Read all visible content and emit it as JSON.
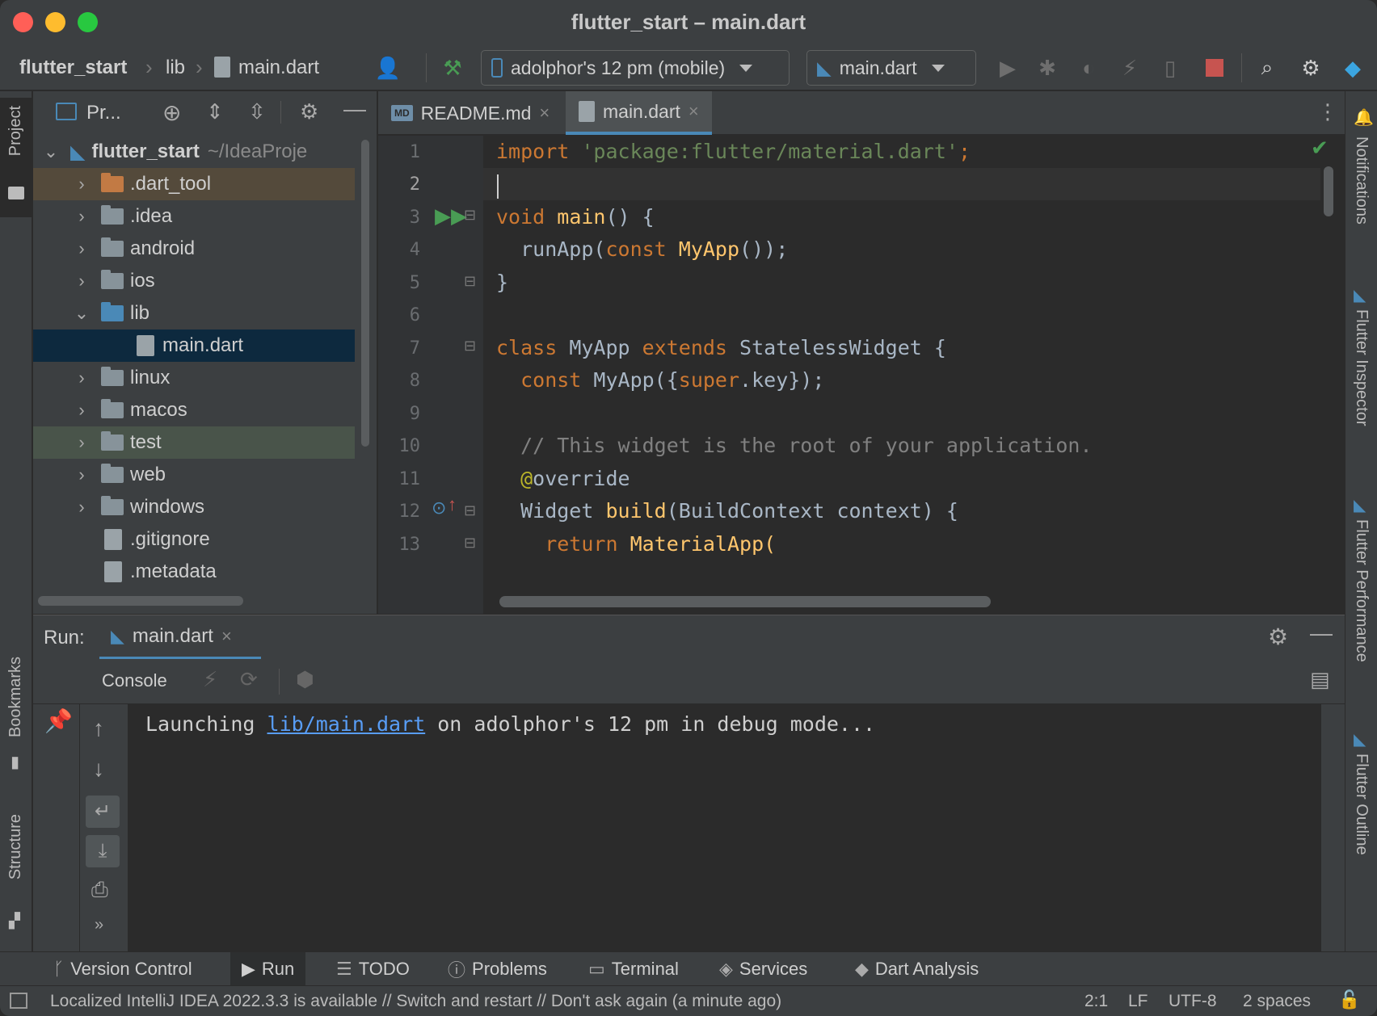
{
  "window": {
    "title": "flutter_start – main.dart"
  },
  "breadcrumb": {
    "project": "flutter_start",
    "folder": "lib",
    "file": "main.dart"
  },
  "toolbar": {
    "device": "adolphor's 12 pm (mobile)",
    "run_config": "main.dart"
  },
  "project_panel": {
    "title": "Pr...",
    "root_name": "flutter_start",
    "root_path": "~/IdeaProje",
    "items": [
      {
        "label": ".dart_tool"
      },
      {
        "label": ".idea"
      },
      {
        "label": "android"
      },
      {
        "label": "ios"
      },
      {
        "label": "lib"
      },
      {
        "label": "main.dart"
      },
      {
        "label": "linux"
      },
      {
        "label": "macos"
      },
      {
        "label": "test"
      },
      {
        "label": "web"
      },
      {
        "label": "windows"
      },
      {
        "label": ".gitignore"
      },
      {
        "label": ".metadata"
      }
    ]
  },
  "editor": {
    "tabs": [
      {
        "label": "README.md",
        "badge": "MD"
      },
      {
        "label": "main.dart"
      }
    ],
    "line_numbers": [
      "1",
      "2",
      "3",
      "4",
      "5",
      "6",
      "7",
      "8",
      "9",
      "10",
      "11",
      "12",
      "13"
    ],
    "lines": {
      "l1a": "import ",
      "l1b": "'package:flutter/material.dart'",
      "l1c": ";",
      "l3a": "void ",
      "l3b": "main",
      "l3c": "() {",
      "l4a": "  runApp(",
      "l4b": "const ",
      "l4c": "MyApp",
      "l4d": "());",
      "l5": "}",
      "l7a": "class ",
      "l7b": "MyApp ",
      "l7c": "extends ",
      "l7d": "StatelessWidget {",
      "l8a": "  const ",
      "l8b": "MyApp({",
      "l8c": "super",
      "l8d": ".key});",
      "l10": "  // This widget is the root of your application.",
      "l11a": "  @",
      "l11b": "override",
      "l12a": "  Widget ",
      "l12b": "build",
      "l12c": "(BuildContext context) {",
      "l13a": "    return ",
      "l13b": "MaterialApp("
    }
  },
  "run_panel": {
    "label": "Run:",
    "tab": "main.dart",
    "console_label": "Console",
    "output_prefix": "Launching ",
    "output_link": "lib/main.dart",
    "output_suffix": " on adolphor's 12 pm in debug mode..."
  },
  "left_strip": {
    "project": "Project",
    "bookmarks": "Bookmarks",
    "structure": "Structure"
  },
  "right_strip": {
    "notifications": "Notifications",
    "inspector": "Flutter Inspector",
    "performance": "Flutter Performance",
    "outline": "Flutter Outline"
  },
  "tool_windows": [
    {
      "label": "Version Control"
    },
    {
      "label": "Run"
    },
    {
      "label": "TODO"
    },
    {
      "label": "Problems"
    },
    {
      "label": "Terminal"
    },
    {
      "label": "Services"
    },
    {
      "label": "Dart Analysis"
    }
  ],
  "status_bar": {
    "message": "Localized IntelliJ IDEA 2022.3.3 is available // Switch and restart // Don't ask again (a minute ago)",
    "position": "2:1",
    "line_sep": "LF",
    "encoding": "UTF-8",
    "indent": "2 spaces"
  },
  "colors": {
    "accent": "#4a89b7",
    "selection": "#0d293e",
    "stop": "#c75450",
    "run_green": "#499c54"
  }
}
